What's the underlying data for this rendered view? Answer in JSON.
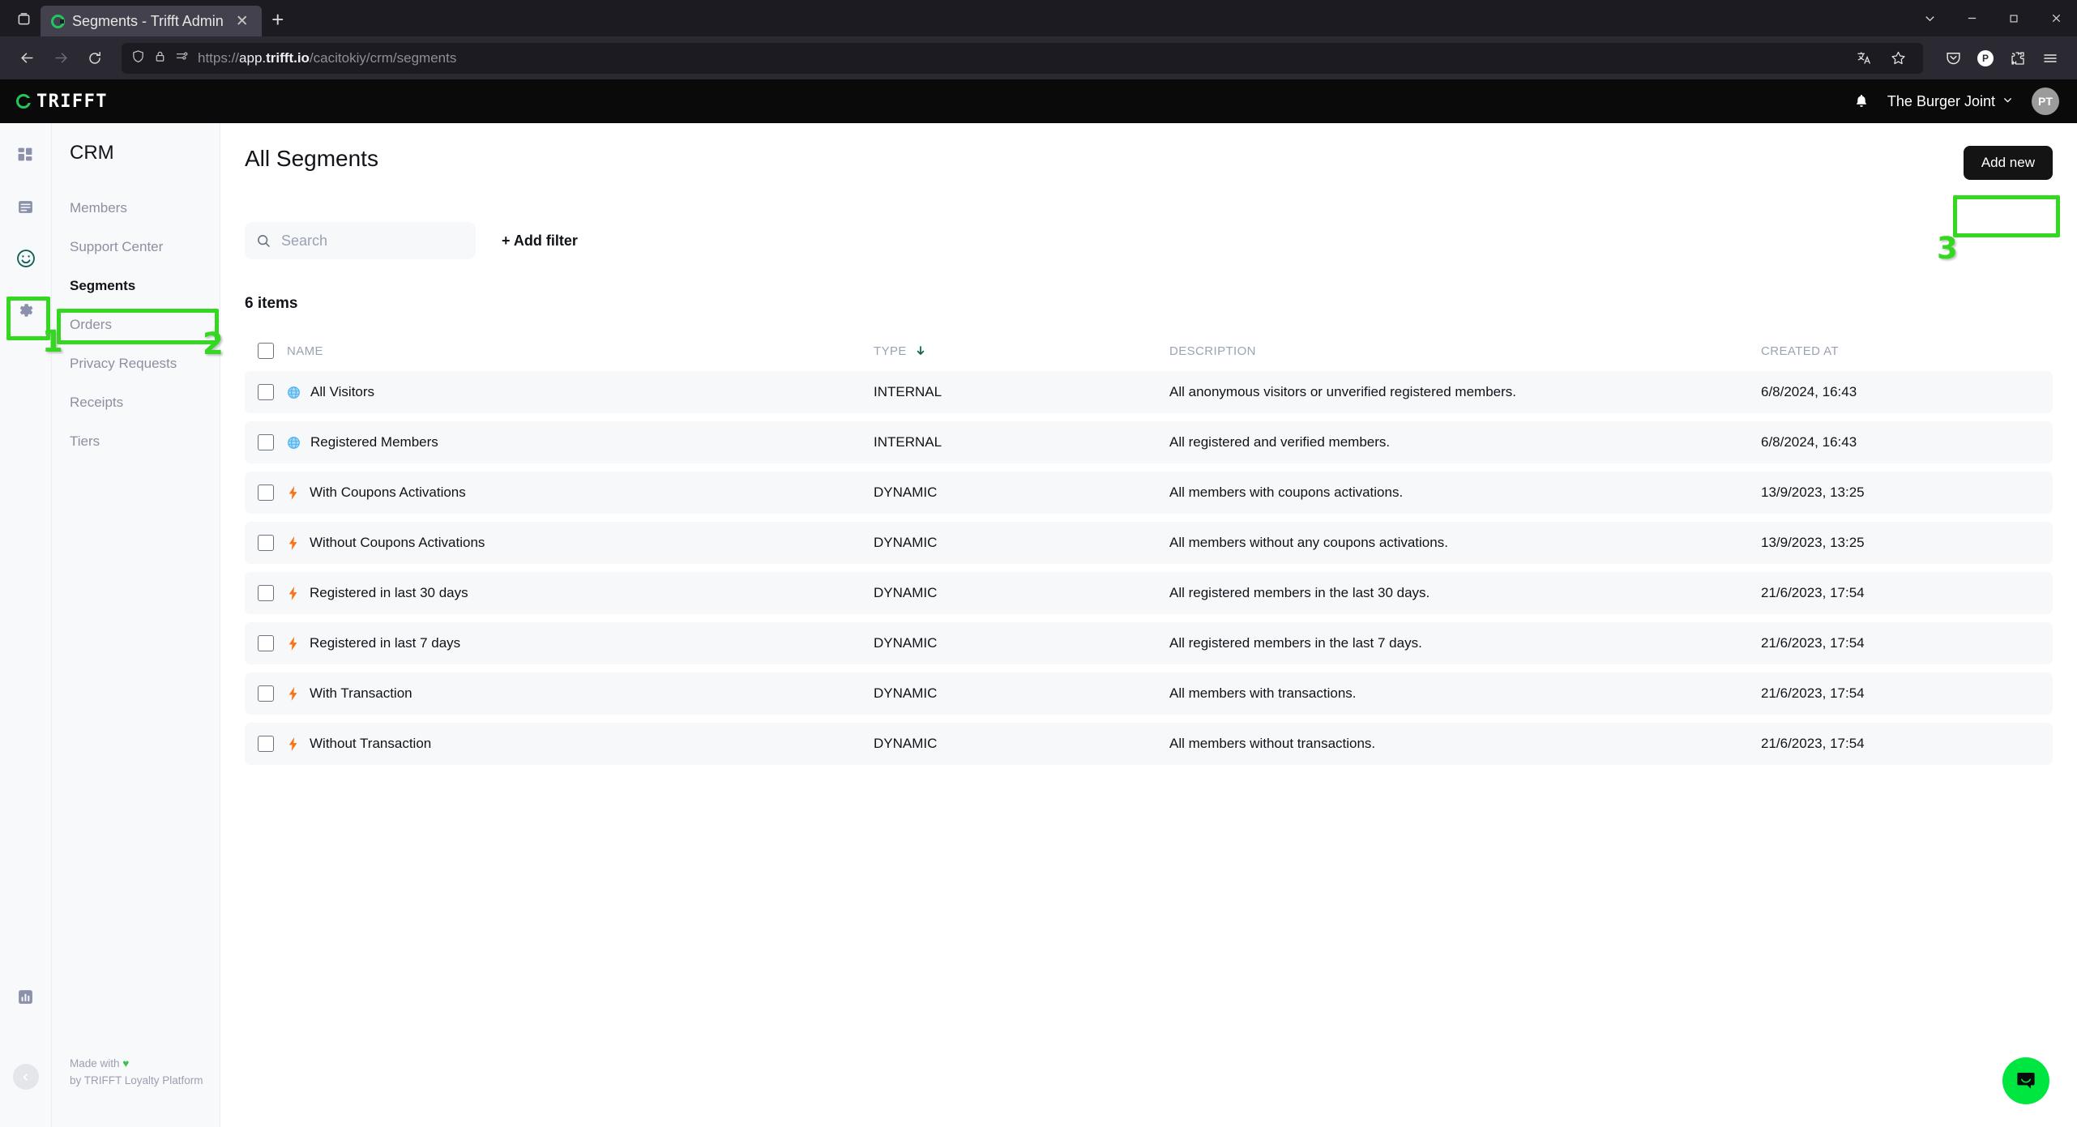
{
  "browser": {
    "tab": {
      "title": "Segments - Trifft Admin",
      "favicon_icon": "trifft-logo-icon",
      "close_icon": "close-icon"
    },
    "new_tab_icon": "plus-icon",
    "tab_list_icon": "tab-list-icon",
    "window_controls": {
      "dropdown_icon": "chevron-down-icon",
      "minimize_icon": "minimize-icon",
      "maximize_icon": "maximize-icon",
      "close_icon": "close-icon"
    },
    "nav": {
      "back_icon": "back-arrow-icon",
      "forward_icon": "forward-arrow-icon",
      "reload_icon": "reload-icon"
    },
    "url": {
      "scheme": "https://",
      "domain_prefix": "app.",
      "domain_bold": "trifft.io",
      "path": "/cacitokiy/crm/segments",
      "shield_icon": "shield-icon",
      "lock_icon": "lock-icon",
      "permissions_icon": "page-permissions-icon"
    },
    "urlbar_right": {
      "translate_icon": "translate-icon",
      "bookmark_icon": "bookmark-star-icon"
    },
    "toolbar_right": {
      "pocket_icon": "pocket-icon",
      "profile_label": "P",
      "extensions_icon": "extensions-icon",
      "menu_icon": "hamburger-menu-icon"
    }
  },
  "app_header": {
    "brand": "TRIFFT",
    "brand_mark_icon": "trifft-ring-icon",
    "bell_icon": "notification-bell-icon",
    "org_name": "The Burger Joint",
    "org_chevron_icon": "chevron-down-icon",
    "avatar_initials": "PT"
  },
  "icon_rail": [
    {
      "name": "dashboard-icon",
      "active": false
    },
    {
      "name": "content-icon",
      "active": false
    },
    {
      "name": "crm-smiley-icon",
      "active": true
    },
    {
      "name": "settings-gear-icon",
      "active": false
    }
  ],
  "rail_bottom": {
    "analytics_icon": "analytics-bar-chart-icon",
    "collapse_icon": "chevron-left-icon"
  },
  "sidebar": {
    "section_title": "CRM",
    "items": [
      {
        "label": "Members",
        "active": false
      },
      {
        "label": "Support Center",
        "active": false
      },
      {
        "label": "Segments",
        "active": true
      },
      {
        "label": "Orders",
        "active": false
      },
      {
        "label": "Privacy Requests",
        "active": false
      },
      {
        "label": "Receipts",
        "active": false
      },
      {
        "label": "Tiers",
        "active": false
      }
    ],
    "footer_line1": "Made with",
    "footer_heart": "♥",
    "footer_line2": "by TRIFFT Loyalty Platform"
  },
  "main": {
    "page_title": "All Segments",
    "add_new_label": "Add new",
    "search_placeholder": "Search",
    "search_value": "",
    "search_icon": "search-icon",
    "add_filter_label": "+ Add filter",
    "items_count": "6 items",
    "columns": {
      "name": "NAME",
      "type": "TYPE",
      "description": "DESCRIPTION",
      "created_at": "CREATED AT",
      "sort_icon": "sort-descending-arrow-icon"
    },
    "rows": [
      {
        "icon": "globe-internal-icon",
        "name": "All Visitors",
        "type": "INTERNAL",
        "description": "All anonymous visitors or unverified registered members.",
        "created_at": "6/8/2024, 16:43"
      },
      {
        "icon": "globe-internal-icon",
        "name": "Registered Members",
        "type": "INTERNAL",
        "description": "All registered and verified members.",
        "created_at": "6/8/2024, 16:43"
      },
      {
        "icon": "bolt-dynamic-icon",
        "name": "With Coupons Activations",
        "type": "DYNAMIC",
        "description": "All members with coupons activations.",
        "created_at": "13/9/2023, 13:25"
      },
      {
        "icon": "bolt-dynamic-icon",
        "name": "Without Coupons Activations",
        "type": "DYNAMIC",
        "description": "All members without any coupons activations.",
        "created_at": "13/9/2023, 13:25"
      },
      {
        "icon": "bolt-dynamic-icon",
        "name": "Registered in last 30 days",
        "type": "DYNAMIC",
        "description": "All registered members in the last 30 days.",
        "created_at": "21/6/2023, 17:54"
      },
      {
        "icon": "bolt-dynamic-icon",
        "name": "Registered in last 7 days",
        "type": "DYNAMIC",
        "description": "All registered members in the last 7 days.",
        "created_at": "21/6/2023, 17:54"
      },
      {
        "icon": "bolt-dynamic-icon",
        "name": "With Transaction",
        "type": "DYNAMIC",
        "description": "All members with transactions.",
        "created_at": "21/6/2023, 17:54"
      },
      {
        "icon": "bolt-dynamic-icon",
        "name": "Without Transaction",
        "type": "DYNAMIC",
        "description": "All members without transactions.",
        "created_at": "21/6/2023, 17:54"
      }
    ]
  },
  "chat_widget": {
    "icon": "chat-bubble-smile-icon"
  },
  "annotations": [
    {
      "number": "1",
      "target": "crm-smiley-rail-icon"
    },
    {
      "number": "2",
      "target": "segments-nav-item"
    },
    {
      "number": "3",
      "target": "add-new-button"
    }
  ],
  "colors": {
    "brand_green": "#22c55e",
    "annotation_green": "#34d821",
    "dynamic_orange": "#f97316",
    "internal_blue": "#4fb3f0",
    "chat_green": "#00e640"
  }
}
